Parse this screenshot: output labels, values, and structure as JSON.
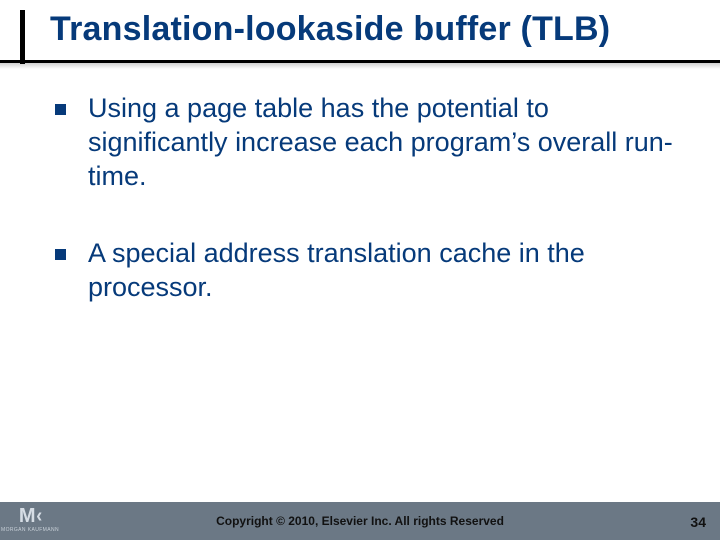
{
  "title": "Translation-lookaside buffer (TLB)",
  "bullets": {
    "b0": "Using a page table has the potential to significantly increase each program’s overall run-time.",
    "b1": "A special address translation cache in the processor."
  },
  "footer": {
    "copyright": "Copyright © 2010, Elsevier Inc. All rights Reserved",
    "page": "34",
    "logo_letters": {
      "m": "M",
      "chevron": "‹",
      "brand": "MORGAN KAUFMANN"
    }
  }
}
